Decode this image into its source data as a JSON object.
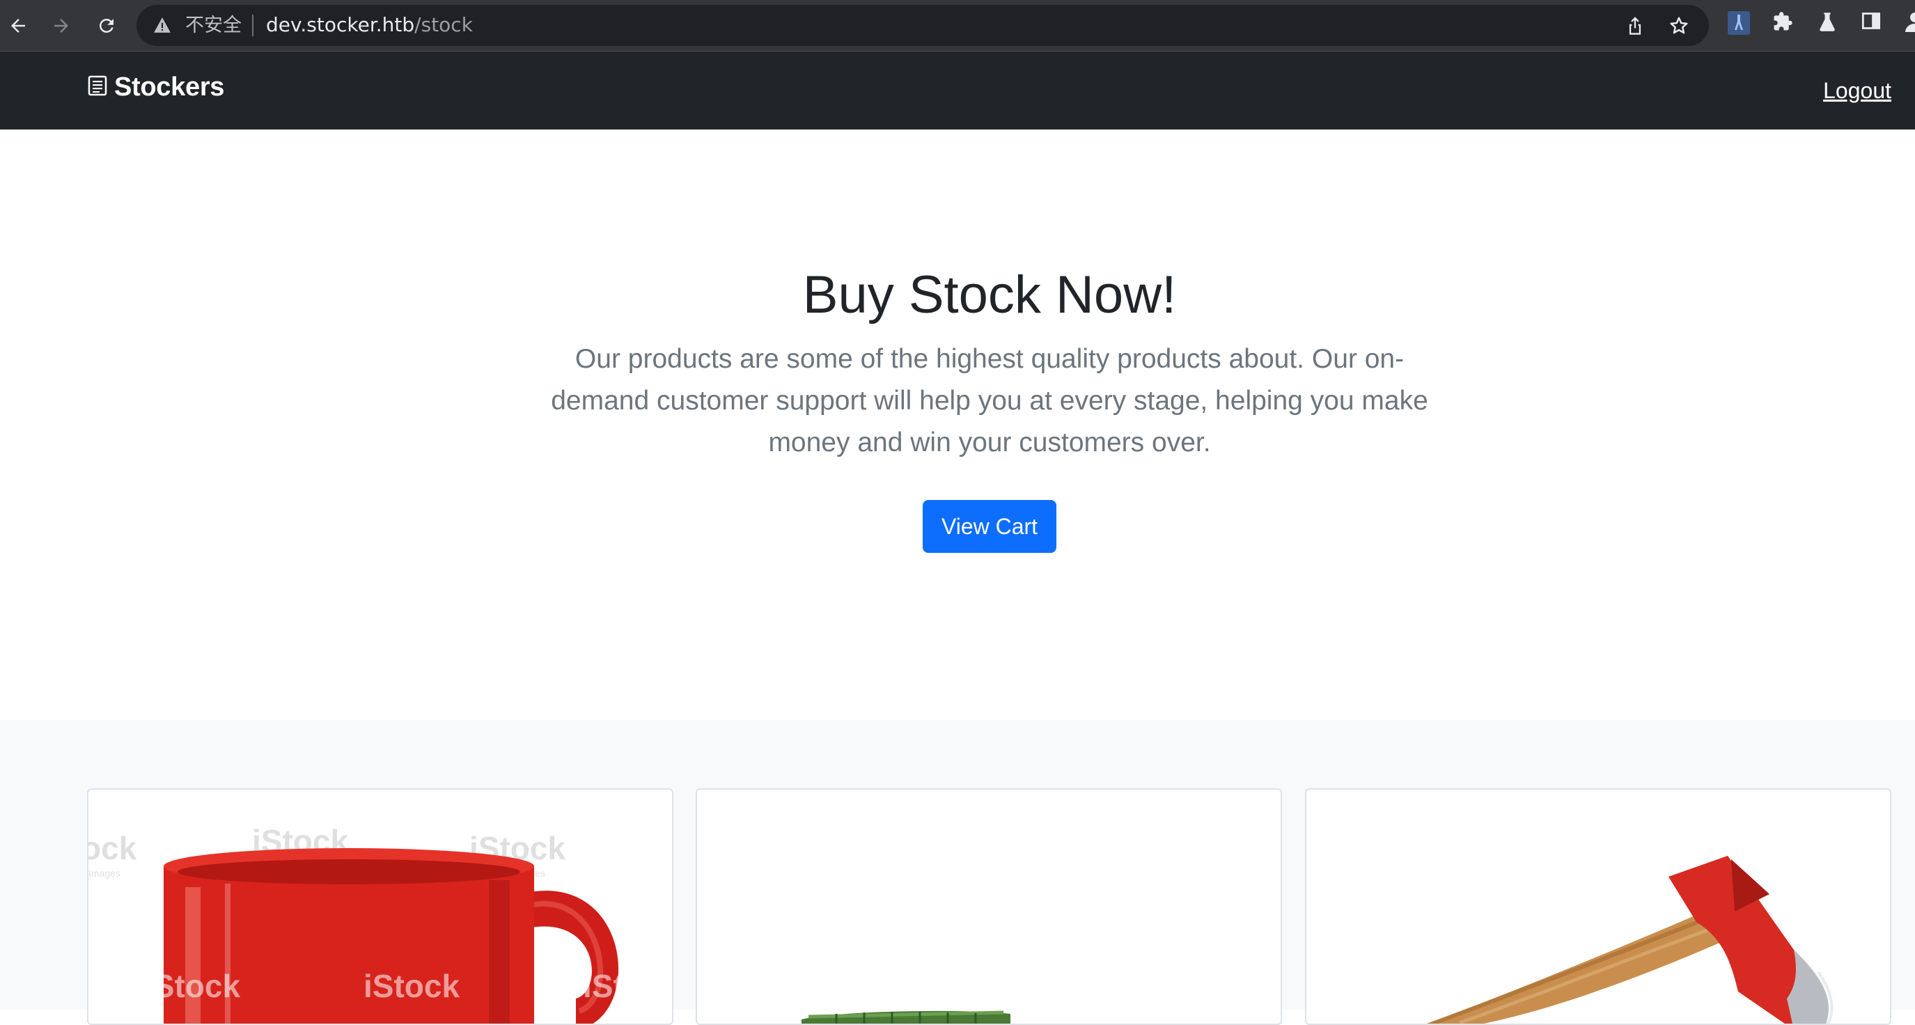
{
  "browser": {
    "security_label": "不安全",
    "url_host": "dev.stocker.htb",
    "url_path": "/stock",
    "icons": [
      "back-arrow-icon",
      "forward-arrow-icon",
      "reload-icon",
      "warning-icon",
      "share-icon",
      "star-icon",
      "extension-icon",
      "puzzle-icon",
      "labs-icon",
      "side-panel-icon",
      "profile-icon"
    ]
  },
  "navbar": {
    "brand": "Stockers",
    "brand_icon": "list-icon",
    "logout_label": "Logout"
  },
  "hero": {
    "title": "Buy Stock Now!",
    "lead": "Our products are some of the highest quality products about. Our on-demand customer support will help you at every stage, helping you make money and win your customers over.",
    "cta_label": "View Cart"
  },
  "products": {
    "cards": [
      {
        "image": "red-mug-image",
        "watermark": "iStock",
        "watermark_sub": "by Getty Images"
      },
      {
        "image": "green-item-image"
      },
      {
        "image": "red-axe-image"
      }
    ]
  },
  "colors": {
    "primary": "#0d6efd",
    "navbar_bg": "#212529",
    "section_bg": "#f8f9fa",
    "muted_text": "#6c757d"
  }
}
